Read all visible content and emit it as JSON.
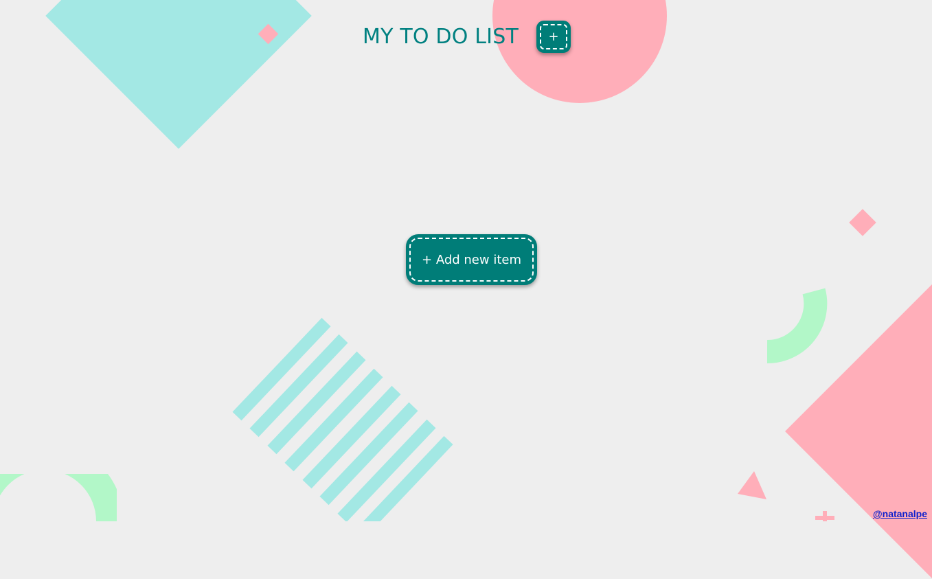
{
  "header": {
    "title": "MY TO DO LIST",
    "add_icon_label": "+"
  },
  "main": {
    "add_item_label": "+ Add new item"
  },
  "footer": {
    "credit_link": "@natanalpe"
  },
  "colors": {
    "background": "#eeeeee",
    "accent_teal": "#008080",
    "button_teal": "#007d78",
    "decor_cyan": "#a3e8e4",
    "decor_pink": "#ffaeb9",
    "decor_green": "#b2f7c8",
    "link": "#1122cc"
  },
  "icons": [
    "plus-icon"
  ]
}
